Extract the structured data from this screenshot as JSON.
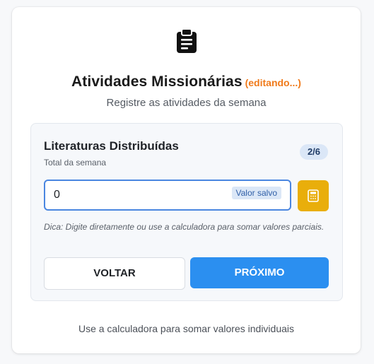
{
  "header": {
    "icon": "clipboard-list-icon",
    "title": "Atividades Missionárias",
    "status": "(editando...)",
    "subtitle": "Registre as atividades da semana"
  },
  "field": {
    "title": "Literaturas Distribuídas",
    "subtitle": "Total da semana",
    "step": "2/6",
    "value": "0",
    "saved_label": "Valor salvo",
    "calculator_icon": "calculator-icon",
    "hint": "Dica: Digite diretamente ou use a calculadora para somar valores parciais."
  },
  "actions": {
    "back_label": "VOLTAR",
    "next_label": "PRÓXIMO"
  },
  "footer": {
    "text": "Use a calculadora para somar valores individuais"
  },
  "colors": {
    "accent": "#2b8ff0",
    "editing": "#f07a1a",
    "calculator": "#e9ae0b",
    "input_border": "#4a86e0"
  }
}
